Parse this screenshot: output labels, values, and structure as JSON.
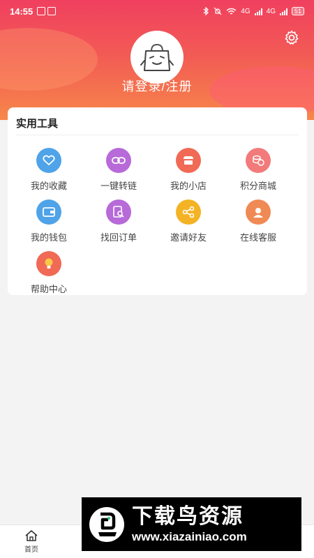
{
  "status_bar": {
    "time": "14:55",
    "network_1": "4G",
    "network_2": "4G",
    "battery": "51"
  },
  "header": {
    "login_label": "请登录/注册",
    "gradient_top": "#f0405f",
    "gradient_bottom": "#f7874a"
  },
  "tools": {
    "title": "实用工具",
    "items": [
      {
        "label": "我的收藏",
        "icon": "heart-icon",
        "color": "#4fa3e8"
      },
      {
        "label": "一键转链",
        "icon": "link-icon",
        "color": "#b76ad8"
      },
      {
        "label": "我的小店",
        "icon": "shop-icon",
        "color": "#f06a55"
      },
      {
        "label": "积分商城",
        "icon": "coins-icon",
        "color": "#f37a7a"
      },
      {
        "label": "我的钱包",
        "icon": "wallet-icon",
        "color": "#4fa3e8"
      },
      {
        "label": "找回订单",
        "icon": "order-search-icon",
        "color": "#b76ad8"
      },
      {
        "label": "邀请好友",
        "icon": "share-icon",
        "color": "#f3b324"
      },
      {
        "label": "在线客服",
        "icon": "customer-service-icon",
        "color": "#f08a55"
      },
      {
        "label": "帮助中心",
        "icon": "lightbulb-icon",
        "color": "#f06a55"
      }
    ]
  },
  "tab_bar": {
    "items": [
      {
        "label": "首页",
        "icon": "home-icon"
      },
      {
        "label": "",
        "icon": ""
      },
      {
        "label": "",
        "icon": ""
      },
      {
        "label": "",
        "icon": ""
      },
      {
        "label": "",
        "icon": ""
      }
    ],
    "active_color": "#f0405f"
  },
  "watermark": {
    "title": "下载鸟资源",
    "url": "www.xiazainiao.com"
  }
}
